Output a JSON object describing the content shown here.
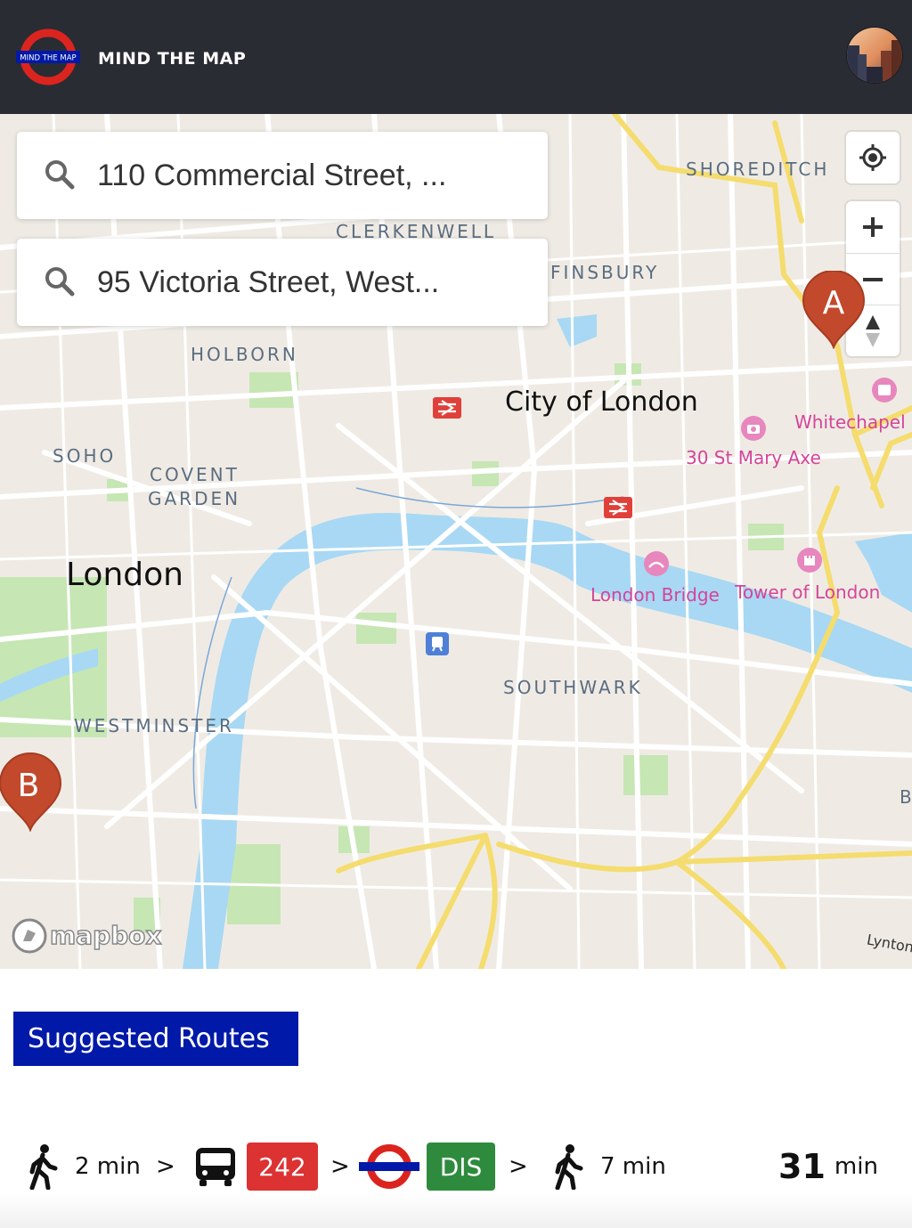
{
  "header": {
    "logo_text": "MIND THE MAP",
    "title": "MIND THE MAP",
    "avatar_icon": "user-avatar"
  },
  "search": {
    "origin_value": "110 Commercial Street, ...",
    "destination_value": "95 Victoria Street, West...",
    "icon": "search-icon"
  },
  "map": {
    "labels": {
      "shoreditch": "SHOREDITCH",
      "clerkenwell": "CLERKENWELL",
      "finsbury": "FINSBURY",
      "holborn": "HOLBORN",
      "city_of_london": "City of London",
      "whitechapel": "Whitechapel",
      "st_mary_axe": "30 St Mary Axe",
      "soho": "SOHO",
      "covent_garden_1": "COVENT",
      "covent_garden_2": "GARDEN",
      "london": "London",
      "london_bridge": "London Bridge",
      "tower_of_london": "Tower of London",
      "southwark": "SOUTHWARK",
      "westminster": "WESTMINSTER",
      "edge_b": "B",
      "lynton": "Lynton"
    },
    "markers": {
      "origin": "A",
      "destination": "B"
    },
    "attribution": "mapbox",
    "controls": [
      "geolocate-icon",
      "zoom-in-icon",
      "zoom-out-icon",
      "compass-icon"
    ]
  },
  "colors": {
    "header_bg": "#2a2c33",
    "suggested_bg": "#0019a8",
    "bus_red": "#dc3232",
    "dlr_green": "#2e8b3d",
    "marker": "#c2492c",
    "water": "#a8d8f4",
    "park": "#c6e6b4",
    "road_major": "#f5dc6e"
  },
  "suggested": {
    "title": "Suggested Routes"
  },
  "route": {
    "walk1": "2 min",
    "sep1": ">",
    "bus_number": "242",
    "sep2": ">",
    "line_code": "DIS",
    "sep3": ">",
    "walk2": "7 min",
    "total_value": "31",
    "total_unit": "min"
  }
}
